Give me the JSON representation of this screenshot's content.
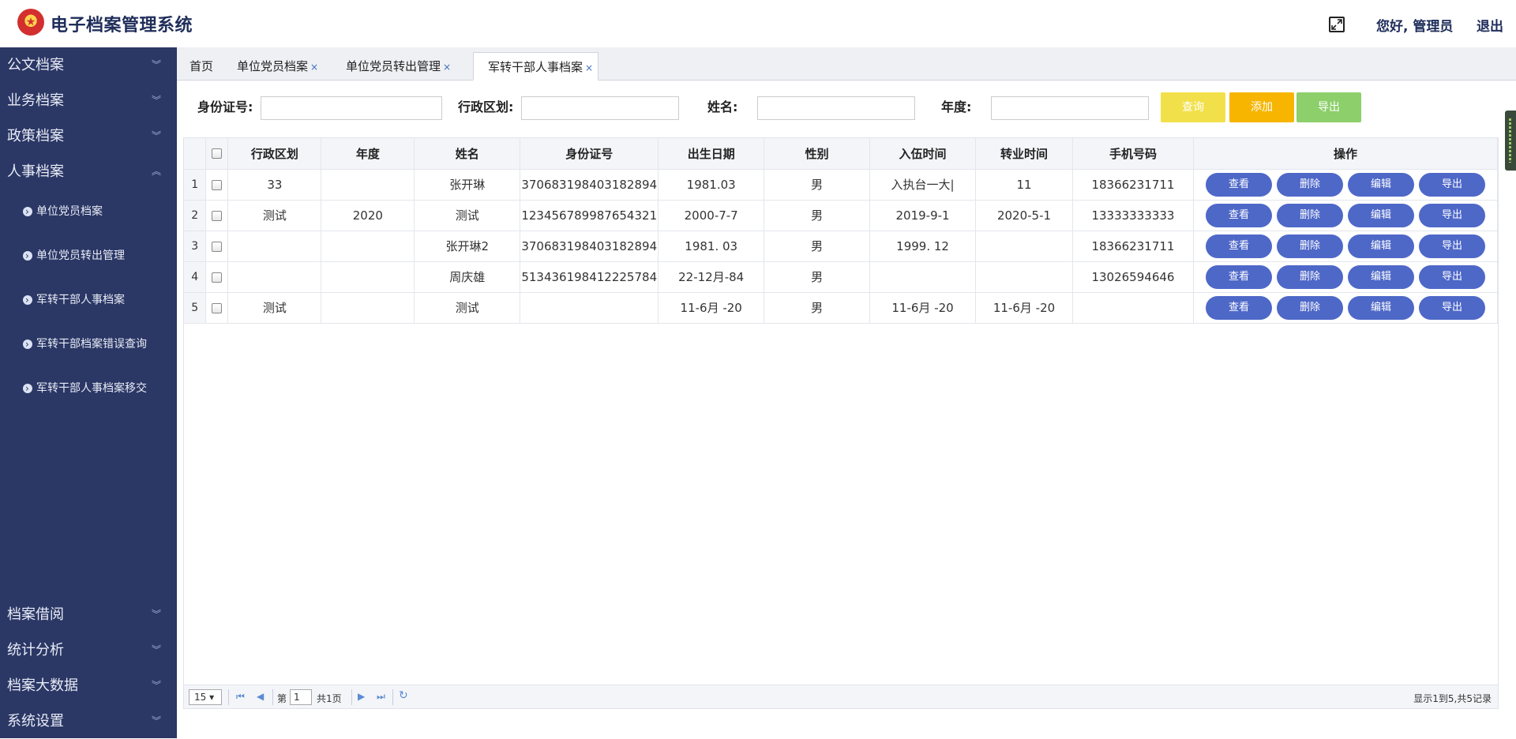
{
  "header": {
    "title": "电子档案管理系统",
    "greeting": "您好, 管理员",
    "logout": "退出"
  },
  "sidebar": {
    "items": [
      {
        "label": "公文档案",
        "expanded": false
      },
      {
        "label": "业务档案",
        "expanded": false
      },
      {
        "label": "政策档案",
        "expanded": false
      },
      {
        "label": "人事档案",
        "expanded": true
      }
    ],
    "sub_items": [
      {
        "label": "单位党员档案"
      },
      {
        "label": "单位党员转出管理"
      },
      {
        "label": "军转干部人事档案"
      },
      {
        "label": "军转干部档案错误查询"
      },
      {
        "label": "军转干部人事档案移交"
      }
    ],
    "bottom_items": [
      {
        "label": "档案借阅"
      },
      {
        "label": "统计分析"
      },
      {
        "label": "档案大数据"
      },
      {
        "label": "系统设置"
      }
    ]
  },
  "tabs": [
    {
      "label": "首页",
      "closable": false,
      "active": false
    },
    {
      "label": "单位党员档案",
      "closable": true,
      "active": false
    },
    {
      "label": "单位党员转出管理",
      "closable": true,
      "active": false
    },
    {
      "label": "军转干部人事档案",
      "closable": true,
      "active": true
    }
  ],
  "search": {
    "id_label": "身份证号:",
    "region_label": "行政区划:",
    "name_label": "姓名:",
    "year_label": "年度:",
    "query_button": "查询",
    "add_button": "添加",
    "export_button": "导出"
  },
  "colors": {
    "sidebar_bg": "#2b3765",
    "query": "#f2e04a",
    "add": "#f7b500",
    "export": "#8ccf6b",
    "op_button": "#4e68c8"
  },
  "table": {
    "columns": [
      "行政区划",
      "年度",
      "姓名",
      "身份证号",
      "出生日期",
      "性别",
      "入伍时间",
      "转业时间",
      "手机号码",
      "操作"
    ],
    "actions": [
      "查看",
      "删除",
      "编辑",
      "导出"
    ],
    "rows": [
      {
        "num": "1",
        "region": "33",
        "year": "",
        "name": "张开琳",
        "id": "370683198403182894",
        "birth": "1981.03",
        "gender": "男",
        "enlist": "入执台一大|",
        "transfer": "11",
        "phone": "18366231711"
      },
      {
        "num": "2",
        "region": "测试",
        "year": "2020",
        "name": "测试",
        "id": "123456789987654321",
        "birth": "2000-7-7",
        "gender": "男",
        "enlist": "2019-9-1",
        "transfer": "2020-5-1",
        "phone": "13333333333"
      },
      {
        "num": "3",
        "region": "",
        "year": "",
        "name": "张开琳2",
        "id": "370683198403182894",
        "birth": "1981. 03",
        "gender": "男",
        "enlist": "1999. 12",
        "transfer": "",
        "phone": "18366231711"
      },
      {
        "num": "4",
        "region": "",
        "year": "",
        "name": "周庆雄",
        "id": "513436198412225784",
        "birth": "22-12月-84",
        "gender": "男",
        "enlist": "",
        "transfer": "",
        "phone": "13026594646"
      },
      {
        "num": "5",
        "region": "测试",
        "year": "",
        "name": "测试",
        "id": "",
        "birth": "11-6月 -20",
        "gender": "男",
        "enlist": "11-6月 -20",
        "transfer": "11-6月 -20",
        "phone": ""
      }
    ]
  },
  "pager": {
    "page_size": "15",
    "page_prefix": "第",
    "current_page": "1",
    "page_total": "共1页",
    "summary": "显示1到5,共5记录"
  }
}
